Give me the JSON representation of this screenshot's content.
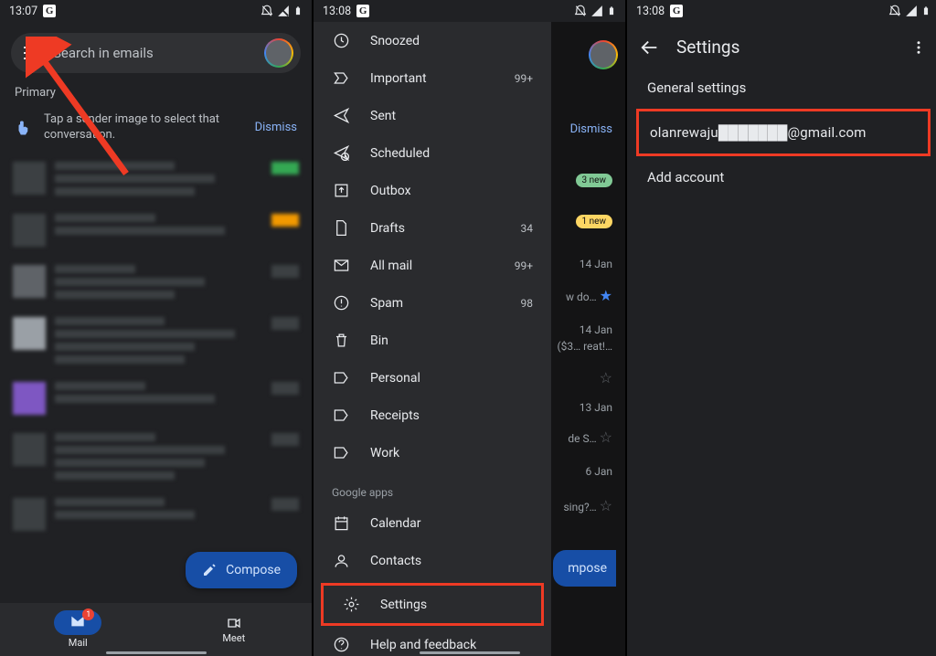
{
  "status": {
    "t1": "13:07",
    "t2": "13:08",
    "t3": "13:08"
  },
  "search": {
    "placeholder": "Search in emails"
  },
  "tab": "Primary",
  "tip": {
    "text": "Tap a sender image to select that conversation.",
    "dismiss": "Dismiss"
  },
  "compose": "Compose",
  "bottom": {
    "mail": "Mail",
    "meet": "Meet",
    "badge": "1"
  },
  "drawer": {
    "items": [
      {
        "icon": "clock",
        "label": "Snoozed",
        "count": ""
      },
      {
        "icon": "important",
        "label": "Important",
        "count": "99+"
      },
      {
        "icon": "send",
        "label": "Sent",
        "count": ""
      },
      {
        "icon": "schedule",
        "label": "Scheduled",
        "count": ""
      },
      {
        "icon": "outbox",
        "label": "Outbox",
        "count": ""
      },
      {
        "icon": "drafts",
        "label": "Drafts",
        "count": "34"
      },
      {
        "icon": "allmail",
        "label": "All mail",
        "count": "99+"
      },
      {
        "icon": "spam",
        "label": "Spam",
        "count": "98"
      },
      {
        "icon": "bin",
        "label": "Bin",
        "count": ""
      },
      {
        "icon": "label",
        "label": "Personal",
        "count": ""
      },
      {
        "icon": "label",
        "label": "Receipts",
        "count": ""
      },
      {
        "icon": "label",
        "label": "Work",
        "count": ""
      }
    ],
    "section": "Google apps",
    "apps": [
      {
        "icon": "calendar",
        "label": "Calendar"
      },
      {
        "icon": "contacts",
        "label": "Contacts"
      }
    ],
    "footer": [
      {
        "icon": "settings",
        "label": "Settings"
      },
      {
        "icon": "help",
        "label": "Help and feedback"
      }
    ]
  },
  "bd": {
    "dismiss": "Dismiss",
    "chips": [
      "3 new",
      "1 new"
    ],
    "dates": [
      "14 Jan",
      "14 Jan",
      "13 Jan",
      "6 Jan"
    ],
    "snips": [
      "w do…",
      "($3… reat!…",
      "de S…",
      "sing?…"
    ],
    "compose": "mpose"
  },
  "settings": {
    "title": "Settings",
    "rows": [
      "General settings",
      "olanrewaju███████@gmail.com",
      "Add account"
    ]
  }
}
